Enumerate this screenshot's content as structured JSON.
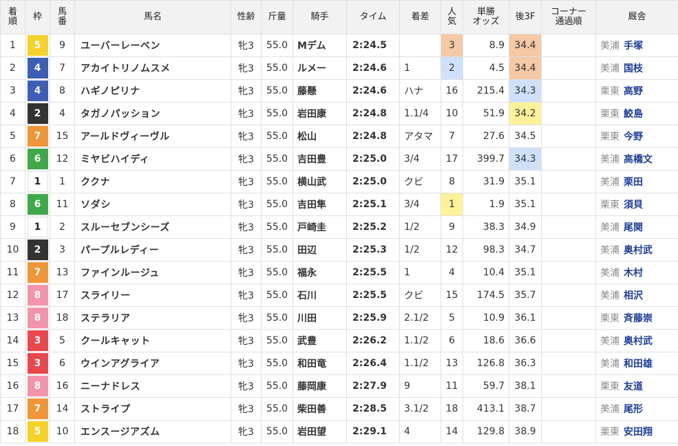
{
  "colors": {
    "header_bg": "#f2f2f2",
    "link_blue": "#1f3e99",
    "odds_red": "#d9363e",
    "pop_highlight": {
      "1": "#fdf29a",
      "2": "#cfe0fb",
      "3": "#f5c9a5"
    },
    "last3f_highlight": {
      "1": "#fdf29a",
      "2": "#cfe0fb",
      "3": "#f5c9a5"
    },
    "waku": {
      "1": {
        "bg": "#ffffff",
        "fg": "#222222"
      },
      "2": {
        "bg": "#333333",
        "fg": "#ffffff"
      },
      "3": {
        "bg": "#e8484e",
        "fg": "#ffffff"
      },
      "4": {
        "bg": "#3e5eb5",
        "fg": "#ffffff"
      },
      "5": {
        "bg": "#f4d12b",
        "fg": "#ffffff"
      },
      "6": {
        "bg": "#3fa84b",
        "fg": "#ffffff"
      },
      "7": {
        "bg": "#f0963a",
        "fg": "#ffffff"
      },
      "8": {
        "bg": "#f294aa",
        "fg": "#ffffff"
      }
    }
  },
  "headers": [
    "着\n順",
    "枠",
    "馬\n番",
    "馬名",
    "性齢",
    "斤量",
    "騎手",
    "タイム",
    "着差",
    "人\n気",
    "単勝\nオッズ",
    "後3F",
    "コーナー\n通過順",
    "厩舎"
  ],
  "rows": [
    {
      "pos": "1",
      "waku": "5",
      "num": "9",
      "horse": "ユーバーレーベン",
      "sexage": "牝3",
      "weight": "55.0",
      "jockey": "Mデム",
      "time": "2:24.5",
      "margin": "",
      "pop": "3",
      "odds": "8.9",
      "last3f": "34.4",
      "l3rank": 3,
      "corner": "",
      "aff": "美浦",
      "trainer": "手塚"
    },
    {
      "pos": "2",
      "waku": "4",
      "num": "7",
      "horse": "アカイトリノムスメ",
      "sexage": "牝3",
      "weight": "55.0",
      "jockey": "ルメー",
      "time": "2:24.6",
      "margin": "1",
      "pop": "2",
      "odds": "4.5",
      "last3f": "34.4",
      "l3rank": 3,
      "corner": "",
      "aff": "美浦",
      "trainer": "国枝"
    },
    {
      "pos": "3",
      "waku": "4",
      "num": "8",
      "horse": "ハギノピリナ",
      "sexage": "牝3",
      "weight": "55.0",
      "jockey": "藤懸",
      "time": "2:24.6",
      "margin": "ハナ",
      "pop": "16",
      "odds": "215.4",
      "last3f": "34.3",
      "l3rank": 2,
      "corner": "",
      "aff": "栗東",
      "trainer": "高野"
    },
    {
      "pos": "4",
      "waku": "2",
      "num": "4",
      "horse": "タガノパッション",
      "sexage": "牝3",
      "weight": "55.0",
      "jockey": "岩田康",
      "time": "2:24.8",
      "margin": "1.1/4",
      "pop": "10",
      "odds": "51.9",
      "last3f": "34.2",
      "l3rank": 1,
      "corner": "",
      "aff": "栗東",
      "trainer": "鮫島"
    },
    {
      "pos": "5",
      "waku": "7",
      "num": "15",
      "horse": "アールドヴィーヴル",
      "sexage": "牝3",
      "weight": "55.0",
      "jockey": "松山",
      "time": "2:24.8",
      "margin": "アタマ",
      "pop": "7",
      "odds": "27.6",
      "last3f": "34.5",
      "l3rank": 0,
      "corner": "",
      "aff": "栗東",
      "trainer": "今野"
    },
    {
      "pos": "6",
      "waku": "6",
      "num": "12",
      "horse": "ミヤビハイディ",
      "sexage": "牝3",
      "weight": "55.0",
      "jockey": "吉田豊",
      "time": "2:25.0",
      "margin": "3/4",
      "pop": "17",
      "odds": "399.7",
      "last3f": "34.3",
      "l3rank": 2,
      "corner": "",
      "aff": "美浦",
      "trainer": "高橋文"
    },
    {
      "pos": "7",
      "waku": "1",
      "num": "1",
      "horse": "ククナ",
      "sexage": "牝3",
      "weight": "55.0",
      "jockey": "横山武",
      "time": "2:25.0",
      "margin": "クビ",
      "pop": "8",
      "odds": "31.9",
      "last3f": "35.1",
      "l3rank": 0,
      "corner": "",
      "aff": "美浦",
      "trainer": "栗田"
    },
    {
      "pos": "8",
      "waku": "6",
      "num": "11",
      "horse": "ソダシ",
      "sexage": "牝3",
      "weight": "55.0",
      "jockey": "吉田隼",
      "time": "2:25.1",
      "margin": "3/4",
      "pop": "1",
      "odds": "1.9",
      "last3f": "35.1",
      "l3rank": 0,
      "corner": "",
      "aff": "栗東",
      "trainer": "須貝"
    },
    {
      "pos": "9",
      "waku": "1",
      "num": "2",
      "horse": "スルーセブンシーズ",
      "sexage": "牝3",
      "weight": "55.0",
      "jockey": "戸崎圭",
      "time": "2:25.2",
      "margin": "1/2",
      "pop": "9",
      "odds": "38.3",
      "last3f": "34.9",
      "l3rank": 0,
      "corner": "",
      "aff": "美浦",
      "trainer": "尾関"
    },
    {
      "pos": "10",
      "waku": "2",
      "num": "3",
      "horse": "パープルレディー",
      "sexage": "牝3",
      "weight": "55.0",
      "jockey": "田辺",
      "time": "2:25.3",
      "margin": "1/2",
      "pop": "12",
      "odds": "98.3",
      "last3f": "34.7",
      "l3rank": 0,
      "corner": "",
      "aff": "美浦",
      "trainer": "奥村武"
    },
    {
      "pos": "11",
      "waku": "7",
      "num": "13",
      "horse": "ファインルージュ",
      "sexage": "牝3",
      "weight": "55.0",
      "jockey": "福永",
      "time": "2:25.5",
      "margin": "1",
      "pop": "4",
      "odds": "10.4",
      "last3f": "35.1",
      "l3rank": 0,
      "corner": "",
      "aff": "美浦",
      "trainer": "木村"
    },
    {
      "pos": "12",
      "waku": "8",
      "num": "17",
      "horse": "スライリー",
      "sexage": "牝3",
      "weight": "55.0",
      "jockey": "石川",
      "time": "2:25.5",
      "margin": "クビ",
      "pop": "15",
      "odds": "174.5",
      "last3f": "35.7",
      "l3rank": 0,
      "corner": "",
      "aff": "美浦",
      "trainer": "相沢"
    },
    {
      "pos": "13",
      "waku": "8",
      "num": "18",
      "horse": "ステラリア",
      "sexage": "牝3",
      "weight": "55.0",
      "jockey": "川田",
      "time": "2:25.9",
      "margin": "2.1/2",
      "pop": "5",
      "odds": "10.9",
      "last3f": "36.1",
      "l3rank": 0,
      "corner": "",
      "aff": "栗東",
      "trainer": "斉藤崇"
    },
    {
      "pos": "14",
      "waku": "3",
      "num": "5",
      "horse": "クールキャット",
      "sexage": "牝3",
      "weight": "55.0",
      "jockey": "武豊",
      "time": "2:26.2",
      "margin": "1.1/2",
      "pop": "6",
      "odds": "18.6",
      "last3f": "36.6",
      "l3rank": 0,
      "corner": "",
      "aff": "美浦",
      "trainer": "奥村武"
    },
    {
      "pos": "15",
      "waku": "3",
      "num": "6",
      "horse": "ウインアグライア",
      "sexage": "牝3",
      "weight": "55.0",
      "jockey": "和田竜",
      "time": "2:26.4",
      "margin": "1.1/2",
      "pop": "13",
      "odds": "126.8",
      "last3f": "36.3",
      "l3rank": 0,
      "corner": "",
      "aff": "美浦",
      "trainer": "和田雄"
    },
    {
      "pos": "16",
      "waku": "8",
      "num": "16",
      "horse": "ニーナドレス",
      "sexage": "牝3",
      "weight": "55.0",
      "jockey": "藤岡康",
      "time": "2:27.9",
      "margin": "9",
      "pop": "11",
      "odds": "59.7",
      "last3f": "38.1",
      "l3rank": 0,
      "corner": "",
      "aff": "栗東",
      "trainer": "友道"
    },
    {
      "pos": "17",
      "waku": "7",
      "num": "14",
      "horse": "ストライプ",
      "sexage": "牝3",
      "weight": "55.0",
      "jockey": "柴田善",
      "time": "2:28.5",
      "margin": "3.1/2",
      "pop": "18",
      "odds": "413.1",
      "last3f": "38.7",
      "l3rank": 0,
      "corner": "",
      "aff": "美浦",
      "trainer": "尾形"
    },
    {
      "pos": "18",
      "waku": "5",
      "num": "10",
      "horse": "エンスージアズム",
      "sexage": "牝3",
      "weight": "55.0",
      "jockey": "岩田望",
      "time": "2:29.1",
      "margin": "4",
      "pop": "14",
      "odds": "129.8",
      "last3f": "38.9",
      "l3rank": 0,
      "corner": "",
      "aff": "栗東",
      "trainer": "安田翔"
    }
  ]
}
